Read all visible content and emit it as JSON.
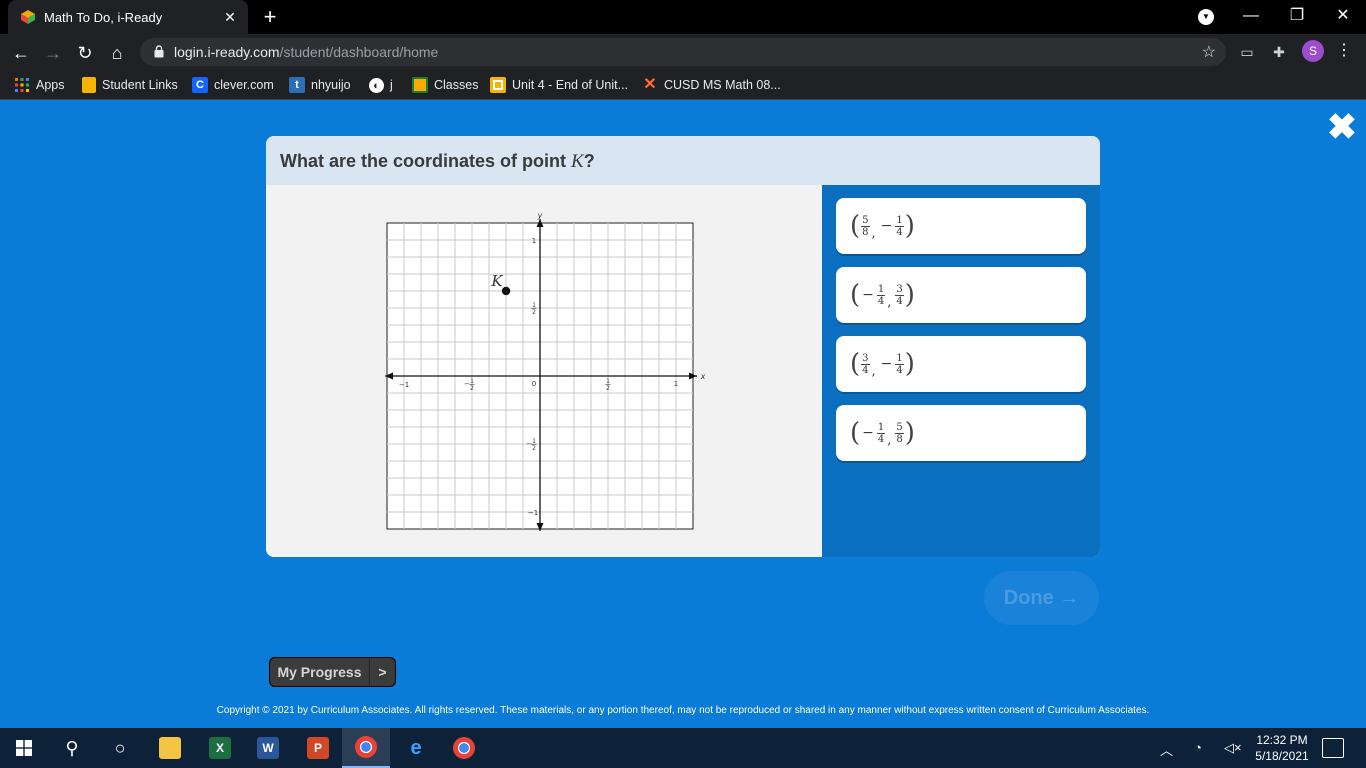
{
  "browser": {
    "tab_title": "Math To Do, i-Ready",
    "tab_close": "✕",
    "new_tab": "+",
    "url_host": "login.i-ready.com",
    "url_path": "/student/dashboard/home",
    "avatar_letter": "S",
    "window_controls": {
      "minimize": "—",
      "restore": "❐",
      "close": "✕"
    }
  },
  "bookmarks": [
    {
      "label": "Apps",
      "icon": "apps-grid-icon",
      "color": "#e8710a"
    },
    {
      "label": "Student Links",
      "icon": "folder-icon",
      "color": "#f4b400"
    },
    {
      "label": "clever.com",
      "icon": "clever-icon",
      "color": "#1464ff",
      "glyph": "C"
    },
    {
      "label": "nhyuijo",
      "icon": "t-icon",
      "color": "#2c6fb5",
      "glyph": "t"
    },
    {
      "label": "j",
      "icon": "globe-icon",
      "color": "#ffffff"
    },
    {
      "label": "Classes",
      "icon": "classroom-icon",
      "color": "#f9ab00"
    },
    {
      "label": "Unit 4 - End of Unit...",
      "icon": "slides-icon",
      "color": "#f4b400"
    },
    {
      "label": "CUSD MS Math 08...",
      "icon": "x-icon",
      "color": "#ff6b35"
    }
  ],
  "question": {
    "text": "What are the coordinates of point ",
    "var": "K",
    "suffix": "?"
  },
  "graph": {
    "axis_x_label": "x",
    "axis_y_label": "y",
    "point_label": "K",
    "point": {
      "x": -0.25,
      "y": 0.625
    },
    "x_range": [
      -1.125,
      1.125
    ],
    "y_range": [
      -1.125,
      1.125
    ],
    "grid_step": 0.125,
    "ticks": {
      "x_neg1": "−1",
      "x_pos1": "1",
      "origin": "0",
      "y_pos1": "1",
      "y_neg1": "−1",
      "half_num": "1",
      "half_den": "2",
      "neg": "−"
    }
  },
  "choices": [
    {
      "a_neg": "",
      "a_num": "5",
      "a_den": "8",
      "b_neg": "−",
      "b_num": "1",
      "b_den": "4"
    },
    {
      "a_neg": "−",
      "a_num": "1",
      "a_den": "4",
      "b_neg": "",
      "b_num": "3",
      "b_den": "4"
    },
    {
      "a_neg": "",
      "a_num": "3",
      "a_den": "4",
      "b_neg": "−",
      "b_num": "1",
      "b_den": "4"
    },
    {
      "a_neg": "−",
      "a_num": "1",
      "a_den": "4",
      "b_neg": "",
      "b_num": "5",
      "b_den": "8"
    }
  ],
  "paren_open": "(",
  "paren_close": ")",
  "comma": ",",
  "done_label": "Done →",
  "close_label": "✖",
  "progress": {
    "label": "My Progress",
    "chevron": ">"
  },
  "copyright": "Copyright © 2021 by Curriculum Associates. All rights reserved. These materials, or any portion thereof, may not be reproduced or shared in any manner without express written consent of Curriculum Associates.",
  "taskbar": {
    "time": "12:32 PM",
    "date": "5/18/2021"
  },
  "colors": {
    "page_bg": "#0a7bd6",
    "answer_panel": "#0b6fc0",
    "header_bg": "#d9e6f1"
  }
}
